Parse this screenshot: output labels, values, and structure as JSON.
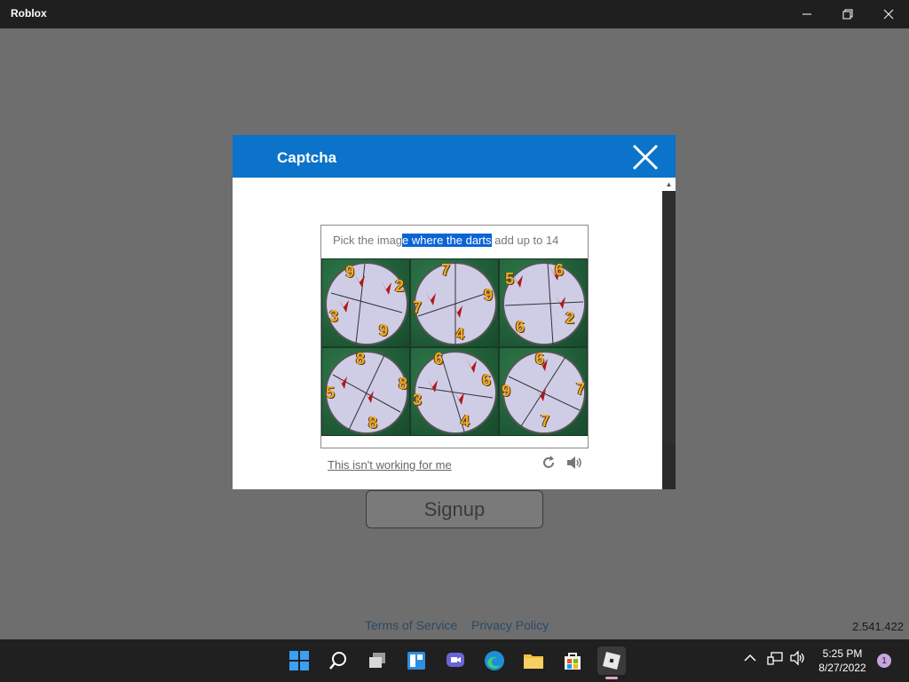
{
  "window": {
    "title": "Roblox",
    "minimize_icon": "minimize-icon",
    "restore_icon": "restore-icon",
    "close_icon": "close-icon"
  },
  "page": {
    "signup_label": "Signup",
    "terms_label": "Terms of Service",
    "privacy_label": "Privacy Policy",
    "version": "2.541.422"
  },
  "captcha": {
    "title": "Captcha",
    "prompt_before": "Pick the imag",
    "prompt_selected": "e where the darts",
    "prompt_after": " add up to 14",
    "help_link": "This isn't working for me",
    "tiles": [
      {
        "numbers": [
          "9",
          "2",
          "3",
          "9"
        ]
      },
      {
        "numbers": [
          "7",
          "7",
          "9",
          "4"
        ]
      },
      {
        "numbers": [
          "5",
          "6",
          "6",
          "2"
        ]
      },
      {
        "numbers": [
          "8",
          "5",
          "8",
          "8"
        ]
      },
      {
        "numbers": [
          "6",
          "3",
          "6",
          "4"
        ]
      },
      {
        "numbers": [
          "6",
          "9",
          "7",
          "7"
        ]
      }
    ]
  },
  "taskbar": {
    "icons": [
      "windows-start-icon",
      "search-icon",
      "task-view-icon",
      "widgets-icon",
      "chat-icon",
      "edge-icon",
      "file-explorer-icon",
      "store-icon",
      "roblox-icon"
    ],
    "time": "5:25 PM",
    "date": "8/27/2022",
    "notification_count": "1"
  },
  "colors": {
    "modal_header": "#0b73c9",
    "selection": "#0a64d6",
    "dart_number": "#f0a92a"
  }
}
